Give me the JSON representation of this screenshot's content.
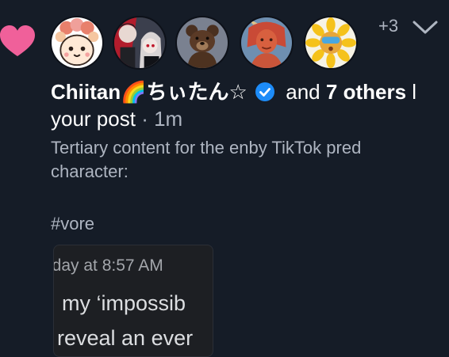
{
  "notification": {
    "type_icon": "heart-icon",
    "accent_color": "#f0609a",
    "avatars": [
      {
        "name": "avatar-chiitan",
        "icon": "chiitan-avatar"
      },
      {
        "name": "avatar-anime-duo",
        "icon": "anime-character-avatar"
      },
      {
        "name": "avatar-bear",
        "icon": "bear-avatar"
      },
      {
        "name": "avatar-red-character",
        "icon": "red-character-avatar"
      },
      {
        "name": "avatar-sunflower",
        "icon": "sunflower-avatar"
      }
    ],
    "more_count": "+3",
    "expand_icon": "chevron-down-icon",
    "actor_name": "Chiitan🌈ちぃたん☆",
    "verified_icon": "verified-badge-icon",
    "and_text": "and",
    "others_text": "7 others",
    "action_tail": "l",
    "target_text": "your post",
    "separator": "·",
    "time_ago": "1m"
  },
  "post": {
    "text": "Tertiary content for the enby TikTok pred character:",
    "hashtag": "#vore",
    "embed": {
      "timestamp": "oday at 8:57 AM",
      "line1": "my ‘impossib",
      "line2": "reveal an ever"
    }
  }
}
